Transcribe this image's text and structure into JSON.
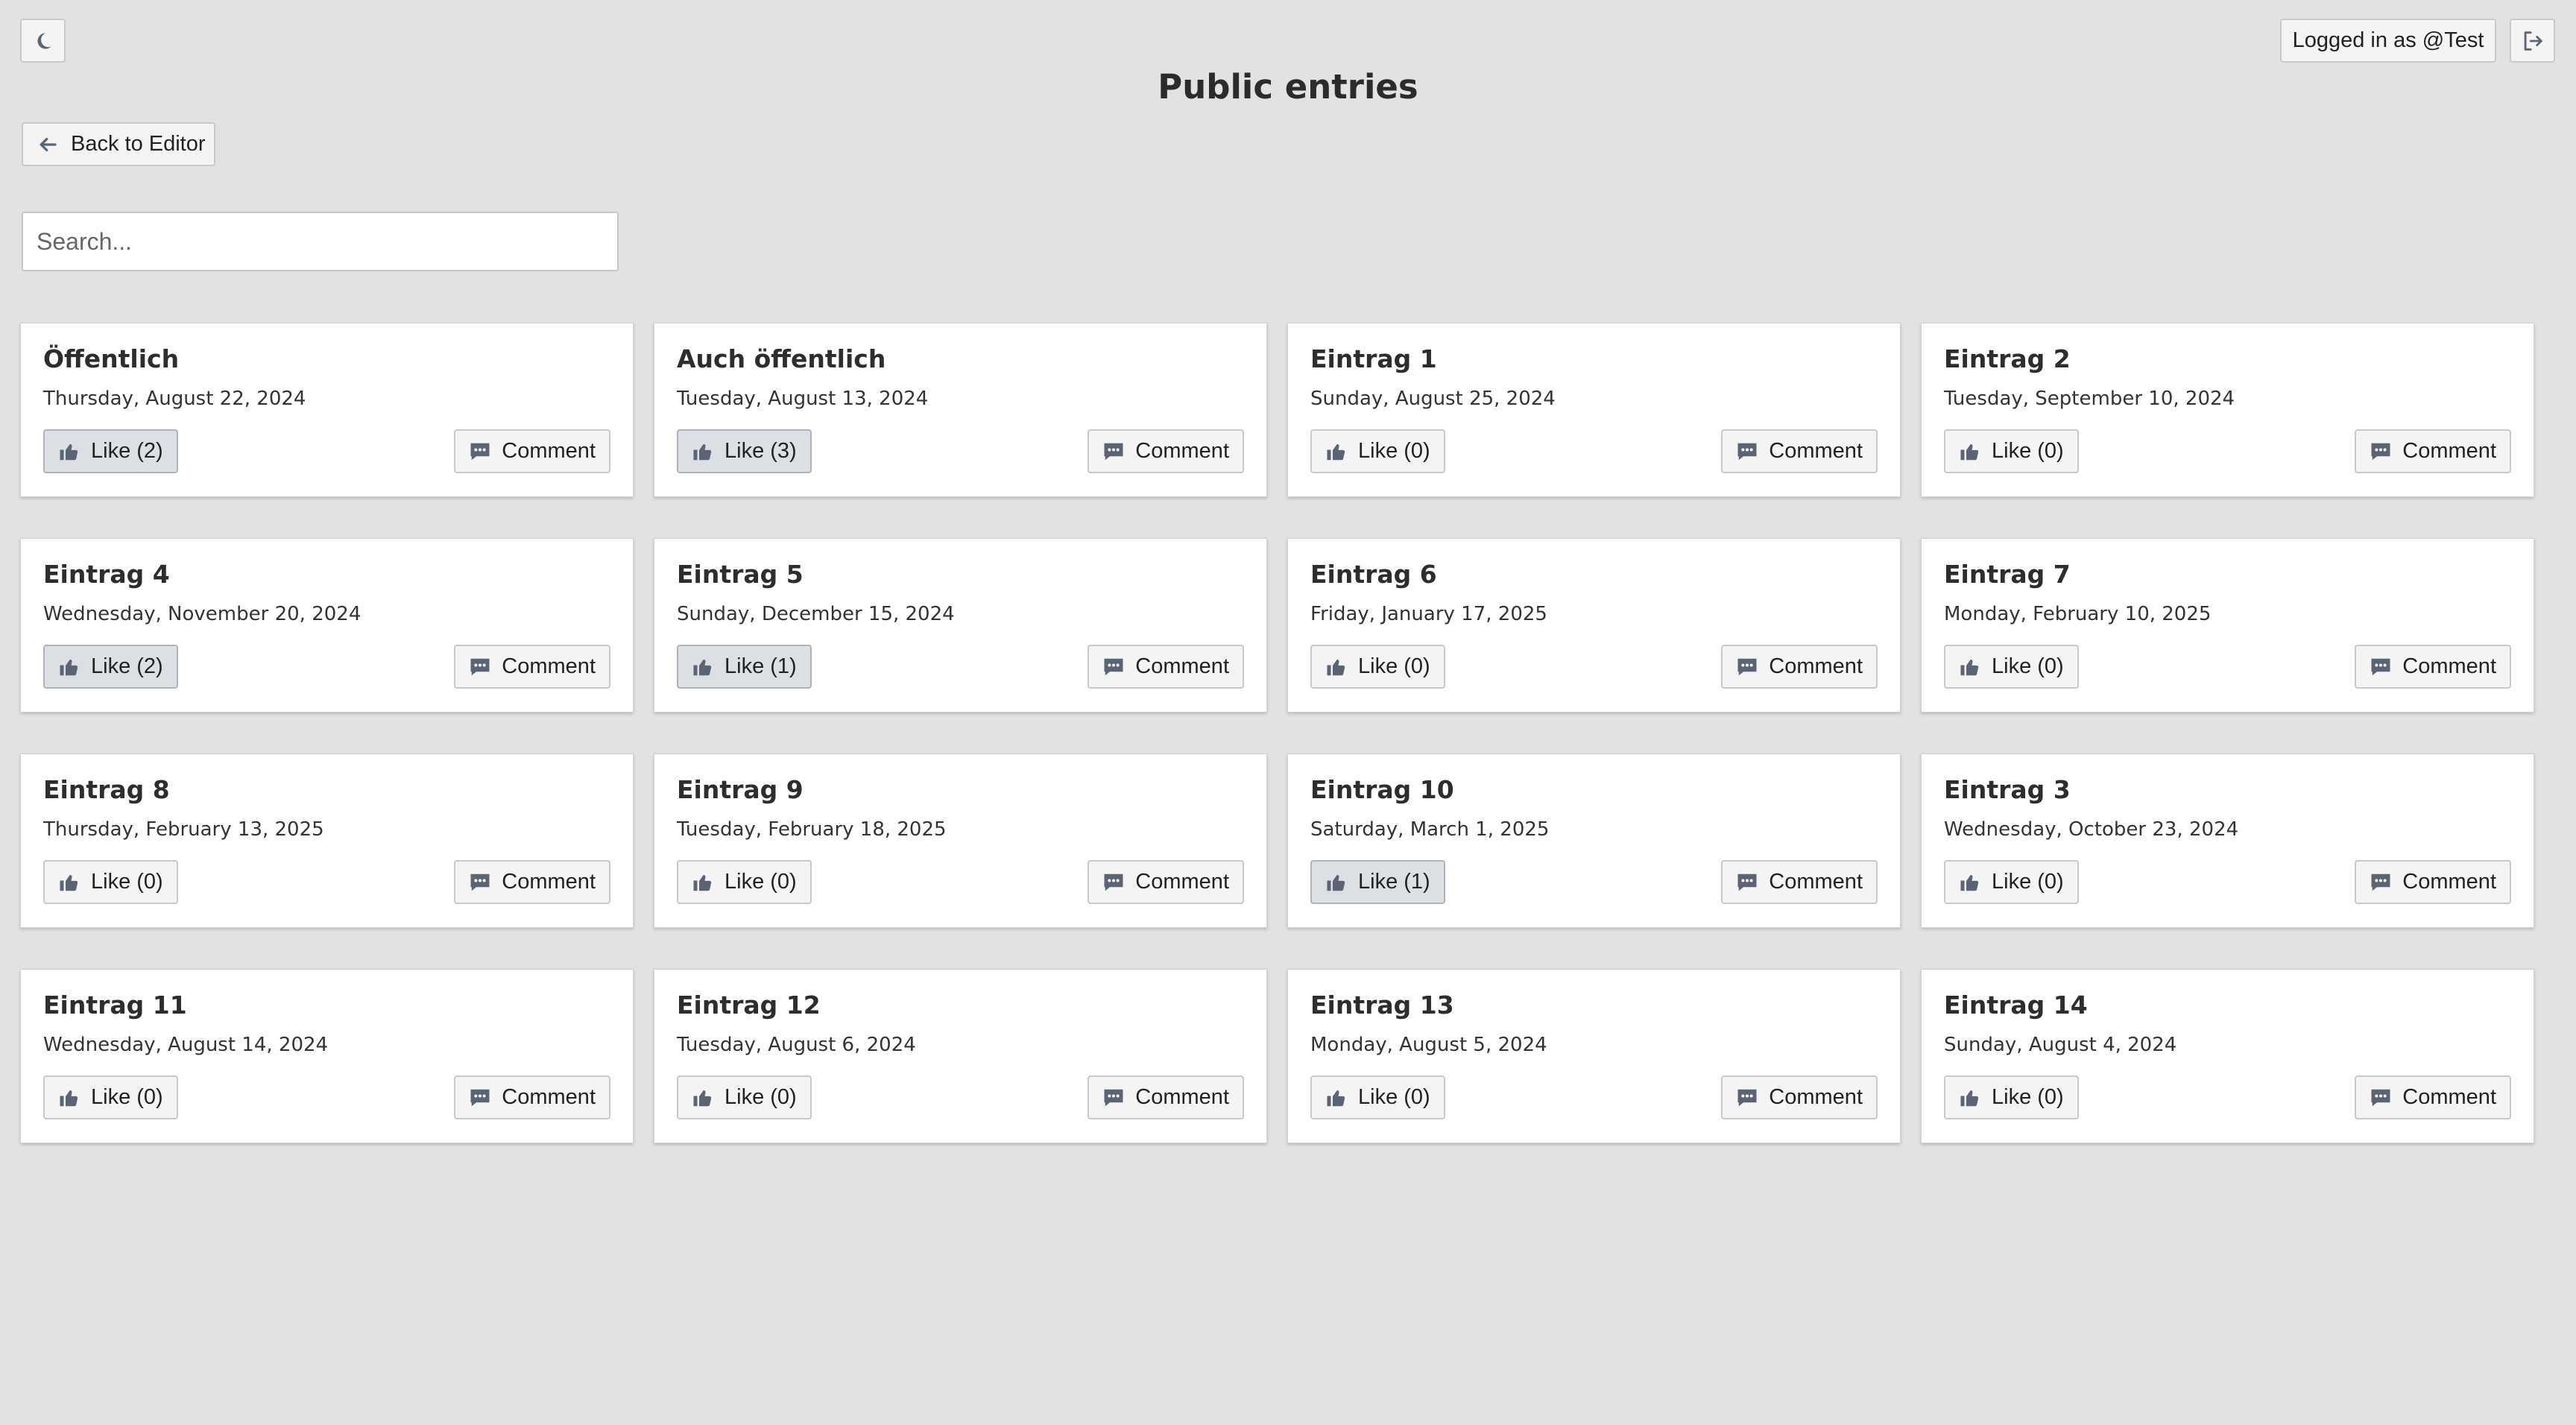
{
  "header": {
    "title": "Public entries",
    "user_badge": "Logged in as @Test",
    "back_label": "Back to Editor",
    "theme_icon": "moon-icon",
    "logout_icon": "logout-icon"
  },
  "search": {
    "placeholder": "Search...",
    "value": ""
  },
  "entries": [
    {
      "title": "Öffentlich",
      "date": "Thursday, August 22, 2024",
      "like": "Like (2)",
      "comment": "Comment",
      "liked": true
    },
    {
      "title": "Auch öffentlich",
      "date": "Tuesday, August 13, 2024",
      "like": "Like (3)",
      "comment": "Comment",
      "liked": true
    },
    {
      "title": "Eintrag 1",
      "date": "Sunday, August 25, 2024",
      "like": "Like (0)",
      "comment": "Comment",
      "liked": false
    },
    {
      "title": "Eintrag 2",
      "date": "Tuesday, September 10, 2024",
      "like": "Like (0)",
      "comment": "Comment",
      "liked": false
    },
    {
      "title": "Eintrag 4",
      "date": "Wednesday, November 20, 2024",
      "like": "Like (2)",
      "comment": "Comment",
      "liked": true
    },
    {
      "title": "Eintrag 5",
      "date": "Sunday, December 15, 2024",
      "like": "Like (1)",
      "comment": "Comment",
      "liked": true
    },
    {
      "title": "Eintrag 6",
      "date": "Friday, January 17, 2025",
      "like": "Like (0)",
      "comment": "Comment",
      "liked": false
    },
    {
      "title": "Eintrag 7",
      "date": "Monday, February 10, 2025",
      "like": "Like (0)",
      "comment": "Comment",
      "liked": false
    },
    {
      "title": "Eintrag 8",
      "date": "Thursday, February 13, 2025",
      "like": "Like (0)",
      "comment": "Comment",
      "liked": false
    },
    {
      "title": "Eintrag 9",
      "date": "Tuesday, February 18, 2025",
      "like": "Like (0)",
      "comment": "Comment",
      "liked": false
    },
    {
      "title": "Eintrag 10",
      "date": "Saturday, March 1, 2025",
      "like": "Like (1)",
      "comment": "Comment",
      "liked": true
    },
    {
      "title": "Eintrag 3",
      "date": "Wednesday, October 23, 2024",
      "like": "Like (0)",
      "comment": "Comment",
      "liked": false
    },
    {
      "title": "Eintrag 11",
      "date": "Wednesday, August 14, 2024",
      "like": "Like (0)",
      "comment": "Comment",
      "liked": false
    },
    {
      "title": "Eintrag 12",
      "date": "Tuesday, August 6, 2024",
      "like": "Like (0)",
      "comment": "Comment",
      "liked": false
    },
    {
      "title": "Eintrag 13",
      "date": "Monday, August 5, 2024",
      "like": "Like (0)",
      "comment": "Comment",
      "liked": false
    },
    {
      "title": "Eintrag 14",
      "date": "Sunday, August 4, 2024",
      "like": "Like (0)",
      "comment": "Comment",
      "liked": false
    }
  ],
  "colors": {
    "background": "#e2e2e2",
    "card": "#ffffff",
    "icon": "#5b6474",
    "liked_button": "#dcdfe4"
  }
}
